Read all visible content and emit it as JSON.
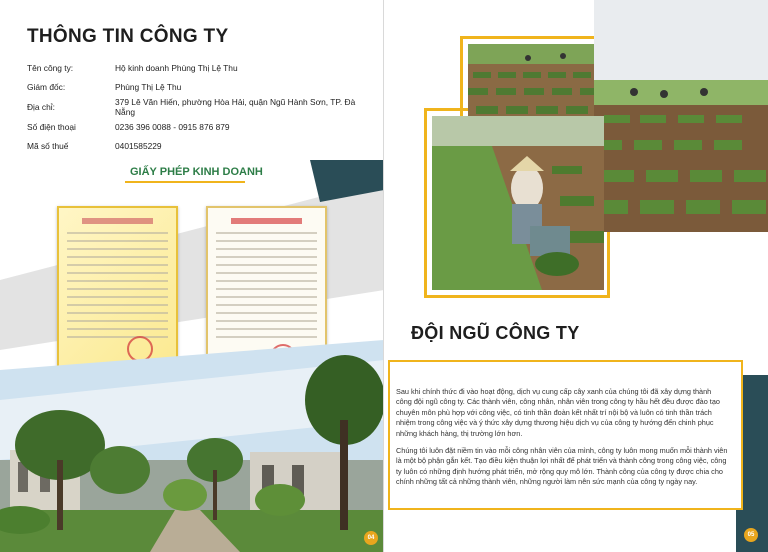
{
  "left_page": {
    "title": "THÔNG TIN CÔNG TY",
    "info": [
      {
        "label": "Tên công ty:",
        "value": "Hộ kinh doanh Phùng Thị Lệ Thu"
      },
      {
        "label": "Giám đốc:",
        "value": "Phùng Thị Lệ Thu"
      },
      {
        "label": "Địa chỉ:",
        "value": "379 Lê Văn Hiến, phường Hòa Hải, quận Ngũ Hành Sơn, TP. Đà Nẵng"
      },
      {
        "label": "Số điện thoại",
        "value": "0236 396 0088 - 0915 876 879"
      },
      {
        "label": "Mã số thuế",
        "value": "0401585229"
      }
    ],
    "license_title": "GIẤY PHÉP KINH DOANH",
    "page_number": "04"
  },
  "right_page": {
    "team_title": "ĐỘI NGŨ CÔNG TY",
    "paragraphs": [
      "Sau khi chính thức đi vào hoạt động, dịch vụ cung cấp cây xanh của chúng tôi đã xây dựng thành công đội ngũ công ty. Các thành viên, công nhân, nhân viên trong công ty hầu hết đều được đào tạo chuyên môn phù hợp với công việc, có tinh thần đoàn kết nhất trí nội bộ và luôn có tinh thần trách nhiệm trong công việc và ý thức xây dựng thương hiệu dịch vụ của công ty hướng đến chinh phục những khách hàng, thị trường lớn hơn.",
      "Chúng tôi luôn đặt niềm tin vào mỗi công nhân viên của mình, công ty luôn mong muốn mỗi thành viên là một bộ phận gắn kết. Tạo điều kiện thuận lợi nhất để phát triển và thành công trong công việc, công ty luôn có những định hướng phát triển, mở rộng quy mô lớn. Thành công của công ty được chia cho chính những tất cả những thành viên, những người làm nên sức mạnh của công ty ngày nay."
    ],
    "page_number": "05"
  },
  "colors": {
    "accent_gold": "#f0b41c",
    "accent_green": "#2d7d47",
    "teal": "#2a4d57",
    "grey_band": "#dcdcdc"
  }
}
